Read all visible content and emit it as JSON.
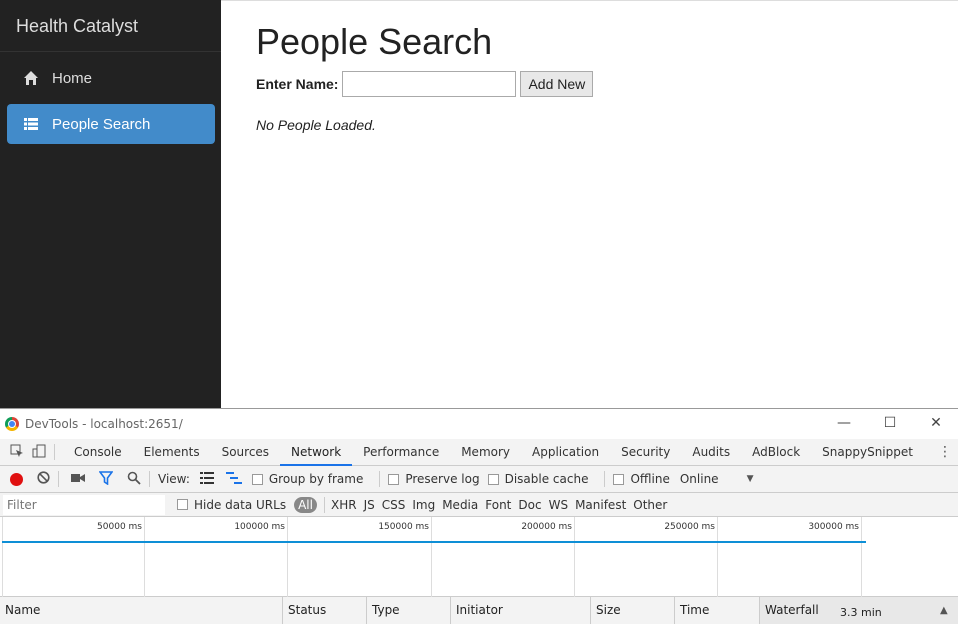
{
  "sidebar": {
    "brand": "Health Catalyst",
    "items": [
      {
        "label": "Home",
        "icon": "home-icon"
      },
      {
        "label": "People Search",
        "icon": "list-icon"
      }
    ]
  },
  "main": {
    "title": "People Search",
    "search_label": "Enter Name:",
    "search_value": "",
    "add_button": "Add New",
    "empty_message": "No People Loaded."
  },
  "devtools": {
    "window_title": "DevTools - localhost:2651/",
    "tabs": [
      "Console",
      "Elements",
      "Sources",
      "Network",
      "Performance",
      "Memory",
      "Application",
      "Security",
      "Audits",
      "AdBlock",
      "SnappySnippet"
    ],
    "active_tab": "Network",
    "toolbar": {
      "view_label": "View:",
      "group_by_frame": "Group by frame",
      "preserve_log": "Preserve log",
      "disable_cache": "Disable cache",
      "offline": "Offline",
      "throttle": "Online"
    },
    "filter": {
      "placeholder": "Filter",
      "hide_data_urls": "Hide data URLs",
      "types": [
        "All",
        "XHR",
        "JS",
        "CSS",
        "Img",
        "Media",
        "Font",
        "Doc",
        "WS",
        "Manifest",
        "Other"
      ]
    },
    "timeline_ticks": [
      "50000 ms",
      "100000 ms",
      "150000 ms",
      "200000 ms",
      "250000 ms",
      "300000 ms"
    ],
    "columns": [
      "Name",
      "Status",
      "Type",
      "Initiator",
      "Size",
      "Time",
      "Waterfall"
    ],
    "waterfall_duration": "3.3 min",
    "accent": "#428bca"
  }
}
